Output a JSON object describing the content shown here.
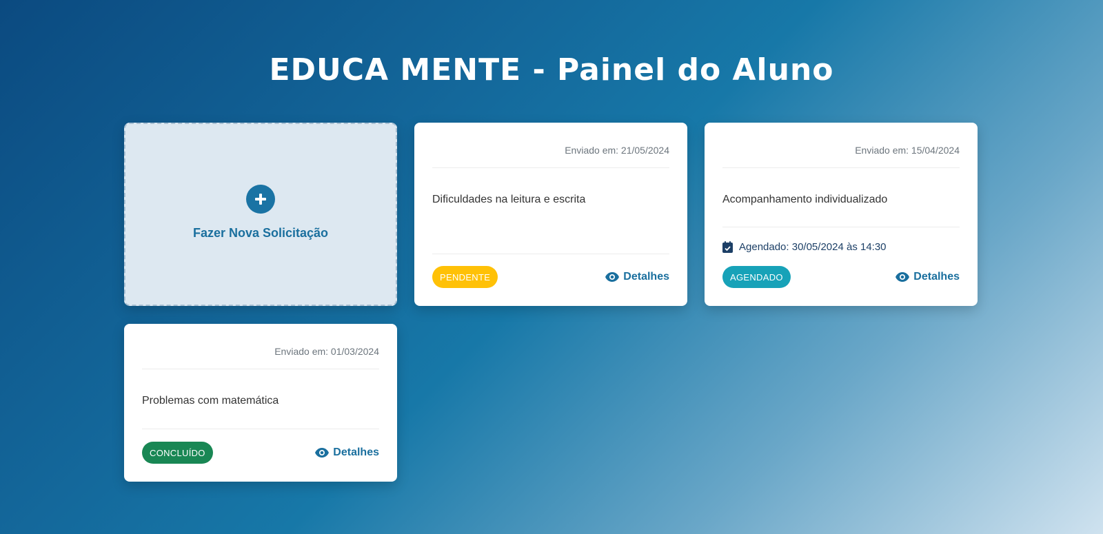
{
  "header": {
    "title": "EDUCA MENTE - Painel do Aluno"
  },
  "new_request": {
    "label": "Fazer Nova Solicitação",
    "icon": "plus-icon"
  },
  "requests": [
    {
      "date": "Enviado em: 21/05/2024",
      "subject": "Dificuldades na leitura e escrita",
      "status": "PENDENTE",
      "status_color": "#ffc107",
      "details_label": "Detalhes"
    },
    {
      "date": "Enviado em: 15/04/2024",
      "subject": "Acompanhamento individualizado",
      "schedule": "Agendado: 30/05/2024 às 14:30",
      "status": "AGENDADO",
      "status_color": "#17a2b8",
      "details_label": "Detalhes"
    },
    {
      "date": "Enviado em: 01/03/2024",
      "subject": "Problemas com matemática",
      "status": "CONCLUÍDO",
      "status_color": "#198754",
      "details_label": "Detalhes"
    }
  ],
  "colors": {
    "accent": "#1a6f9e",
    "schedule_text": "#1c3f66"
  }
}
